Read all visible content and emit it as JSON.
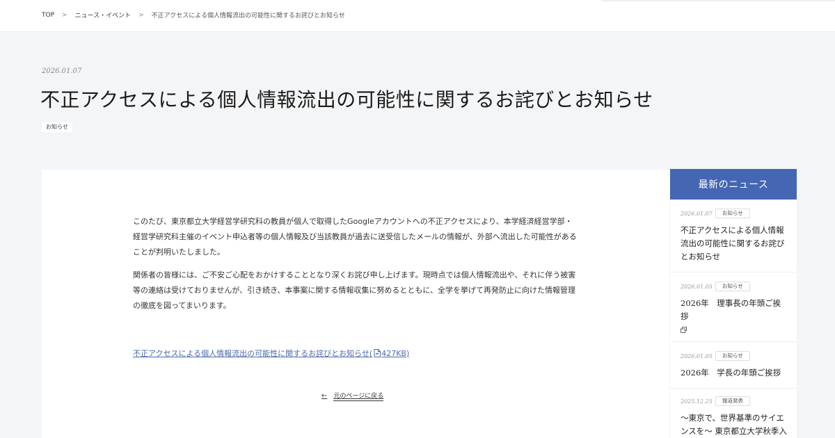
{
  "breadcrumb": {
    "items": [
      "TOP",
      "ニュース・イベント",
      "不正アクセスによる個人情報流出の可能性に関するお詫びとお知らせ"
    ],
    "separator": ">"
  },
  "article": {
    "date": "2026.01.07",
    "title": "不正アクセスによる個人情報流出の可能性に関するお詫びとお知らせ",
    "tag": "お知らせ",
    "paragraphs": [
      "このたび、東京都立大学経営学研究科の教員が個人で取得したGoogleアカウントへの不正アクセスにより、本学経済経営学部・経営学研究科主催のイベント申込者等の個人情報及び当該教員が過去に送受信したメールの情報が、外部へ流出した可能性があることが判明いたしました。",
      "関係者の皆様には、ご不安ご心配をおかけすることとなり深くお詫び申し上げます。現時点では個人情報流出や、それに伴う被害等の連絡は受けておりませんが、引き続き、本事案に関する情報収集に努めるとともに、全学を挙げて再発防止に向けた情報管理の徹底を図ってまいります。"
    ],
    "pdf_link_label": "不正アクセスによる個人情報流出の可能性に関するお詫びとお知らせ(",
    "pdf_size": "427KB)",
    "pdf_icon": "pdf-file-icon",
    "back_arrow": "←",
    "back_label": "元のページに戻る"
  },
  "sidebar": {
    "title": "最新のニュース",
    "items": [
      {
        "date": "2026.01.07",
        "tag": "お知らせ",
        "title": "不正アクセスによる個人情報流出の可能性に関するお詫びとお知らせ",
        "external": false
      },
      {
        "date": "2026.01.05",
        "tag": "お知らせ",
        "title": "2026年　理事長の年頭ご挨拶",
        "external": true
      },
      {
        "date": "2026.01.05",
        "tag": "お知らせ",
        "title": "2026年　学長の年頭ご挨拶",
        "external": false
      },
      {
        "date": "2025.12.25",
        "tag": "報道発表",
        "title": "～東京で、世界基準のサイエンスを～ 東京都立大学秋季入学の学生募集要項公表につい",
        "external": false
      }
    ]
  },
  "colors": {
    "accent": "#4566b2",
    "link": "#4a6aae",
    "background": "#f4f5f6"
  }
}
